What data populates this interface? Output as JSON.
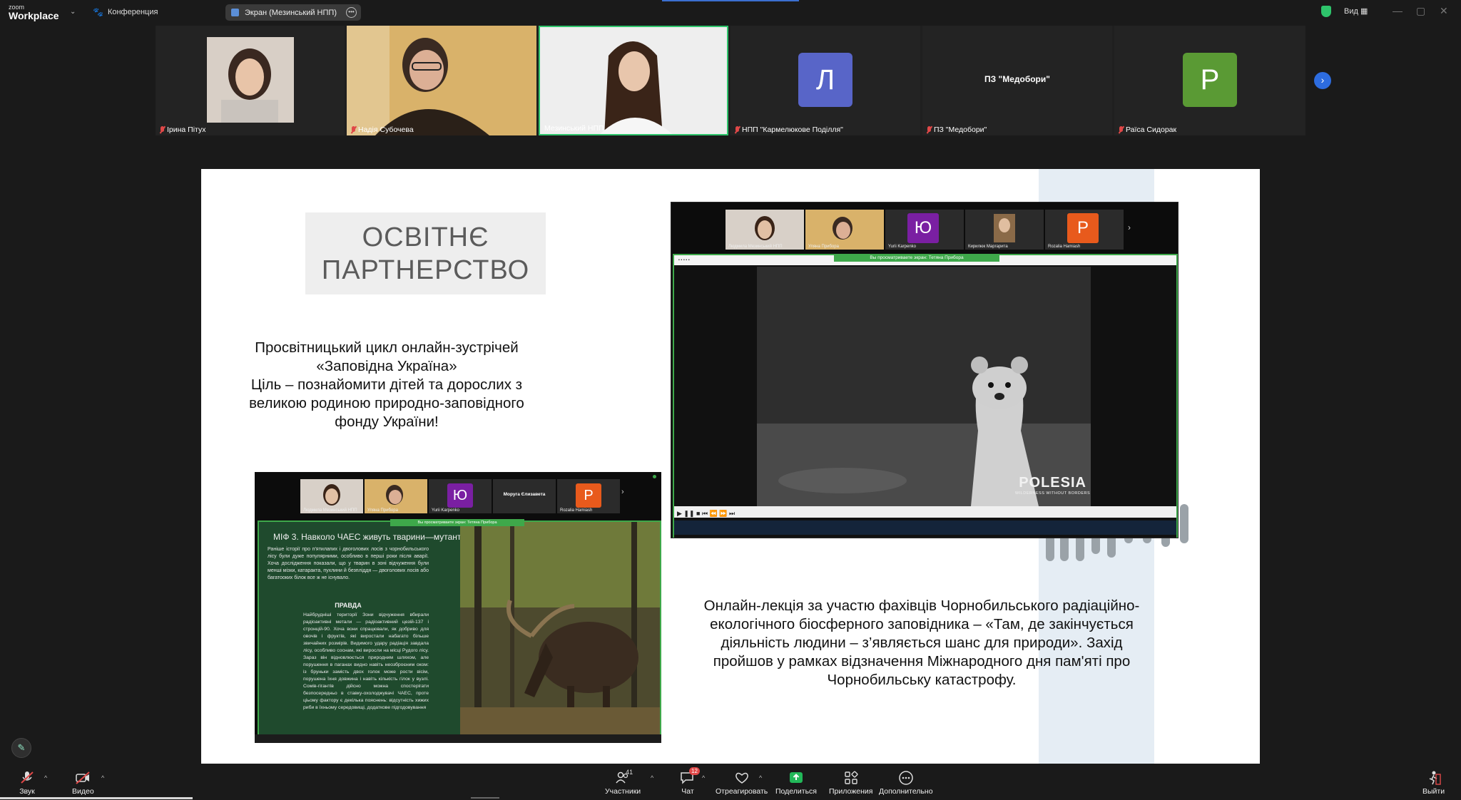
{
  "titlebar": {
    "logo_line1": "zoom",
    "logo_line2": "Workplace",
    "conference_label": "Конференция",
    "screen_share_label": "Экран (Мезинський НПП)",
    "view_label": "Вид"
  },
  "participants": [
    {
      "name": "Ірина Пітух",
      "type": "video"
    },
    {
      "name": "Надія Субочева",
      "type": "video"
    },
    {
      "name": "Мезинський НПП",
      "type": "video",
      "active": true
    },
    {
      "name": "НПП \"Кармелюкове Поділля\"",
      "type": "avatar",
      "letter": "Л",
      "color": "#5865c8"
    },
    {
      "name": "ПЗ \"Медобори\"",
      "type": "text",
      "display": "ПЗ \"Медобори\""
    },
    {
      "name": "Раїса Сидорак",
      "type": "avatar",
      "letter": "Р",
      "color": "#5a9a34"
    }
  ],
  "slide": {
    "title_line1": "ОСВІТНЄ",
    "title_line2": "ПАРТНЕРСТВО",
    "text1_line1": "Просвітницький цикл онлайн-зустрічей",
    "text1_line2": "«Заповідна Україна»",
    "text1_line3": "Ціль – познайомити дітей та дорослих з великою родиною природно-заповідного фонду України!",
    "text2": "Онлайн-лекція за участю фахівців Чорнобильського радіаційно-екологічного біосферного заповідника – «Там, де закінчується діяльність людини – з’являється шанс для природи». Захід пройшов у рамках відзначення Міжнародного дня пам'яті про Чорнобильську катастрофу."
  },
  "shot1": {
    "tiles": [
      {
        "name": "Людмила Мезинський НПП",
        "type": "video"
      },
      {
        "name": "Уляна Прибора",
        "type": "video"
      },
      {
        "name": "Yurii Karpenko",
        "type": "avatar",
        "letter": "Ю",
        "color": "#7a1fa2"
      },
      {
        "name": "Кирилюк Маргарита",
        "type": "video"
      },
      {
        "name": "Rozalia Hamiash",
        "type": "avatar",
        "letter": "Р",
        "color": "#e85a1c"
      }
    ],
    "banner": "Вы просматриваете экран: Тетяна Прибора",
    "watermark": "POLESIA",
    "watermark_sub": "WILDERNESS WITHOUT BORDERS"
  },
  "shot2": {
    "tiles": [
      {
        "name": "Людмила Мезинський НПП",
        "type": "video"
      },
      {
        "name": "Уляна Прибора",
        "type": "video"
      },
      {
        "name": "Yurii Karpenko",
        "type": "avatar",
        "letter": "Ю",
        "color": "#7a1fa2"
      },
      {
        "name": "Моруга Єлизавета",
        "type": "text"
      },
      {
        "name": "Rozalia Hamiash",
        "type": "avatar",
        "letter": "Р",
        "color": "#e85a1c"
      }
    ],
    "banner": "Вы просматриваете экран: Тетяна Прибора",
    "myth_title": "МІФ 3. Навколо ЧАЕС живуть тварини—мутанти",
    "myth_para": "Раніше історії про п'ятилапих і двоголових лосів з чорнобильського лісу були дуже популярними, особливо в перші роки після аварії. Хоча дослідження показали, що у тварин в зоні відчуження були менші мізки, катаракта, пухлини й безпліддя — двоголових лосів або багатооких білок все ж не існувало.",
    "pravda_title": "ПРАВДА",
    "pravda_text": "Найбрудніші території Зони відчуження вбирали радіоактивні метали — радіоактивний цезій-137 і стронцій-90. Хоча вони спрацювали, як добриво для овочів і фруктів, які виростали набагато більше звичайних розмірів. Видимого удару радіація завдала лісу, особливо соснам, які виросли на місці Рудого лісу. Зараз він відновлюється природним шляхом, але порушення в паганах видно навіть неозброєним оком: із бруньки замість двох голок може рости вісім, порушена їхня довжина і навіть кількість гілок у вузлі. Сомів-гігантів дійсно можна спостерігати безпосередньо в ставку-охолоджувачі ЧАЕС, проте ціьому фактору є декілька пояснень: відсутність хижих риби в їхньому середовищі, додаткове підгодовування"
  },
  "toolbar": {
    "audio": "Звук",
    "video": "Видео",
    "participants": "Участники",
    "participants_count": "41",
    "chat": "Чат",
    "chat_badge": "12",
    "react": "Отреагировать",
    "share": "Поделиться",
    "apps": "Приложения",
    "more": "Дополнительно",
    "leave": "Выйти"
  }
}
